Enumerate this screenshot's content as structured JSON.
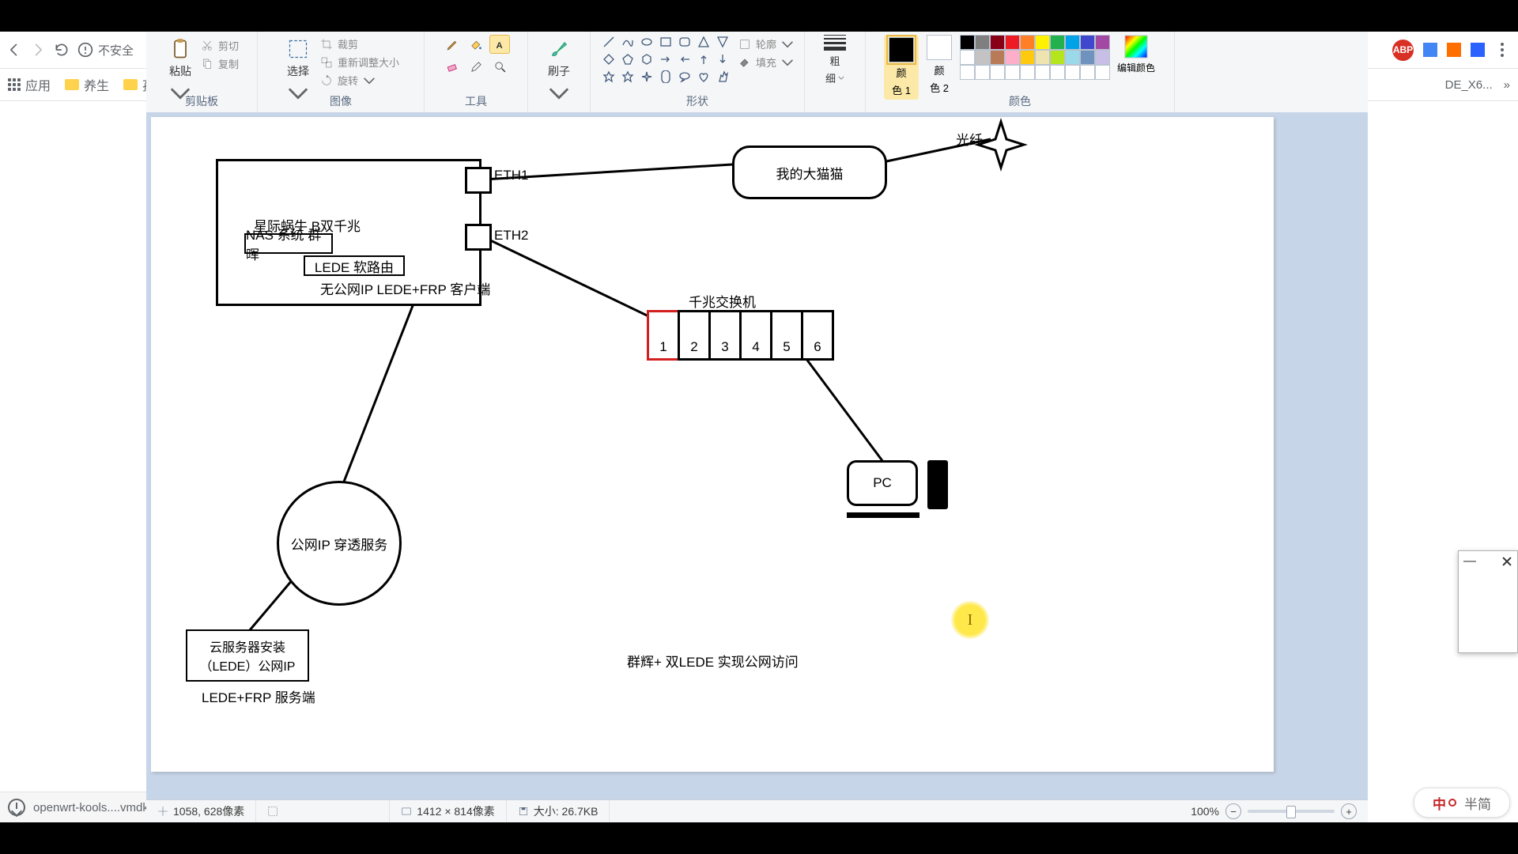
{
  "browser": {
    "back_tooltip": "后退",
    "forward_tooltip": "前进",
    "reload_tooltip": "刷新",
    "url_security_label": "不安全",
    "bookmarks": {
      "apps": "应用",
      "f1": "养生",
      "f2": "孩子"
    },
    "download_filename": "openwrt-kools....vmdk",
    "right_bookmark": "DE_X6...",
    "ext_adblock": "ABP",
    "bookmark_overflow": "»"
  },
  "ime": {
    "mode": "中",
    "engine": "半简"
  },
  "paint": {
    "ribbon": {
      "g_clipboard": "剪贴板",
      "paste": "粘贴",
      "cut": "剪切",
      "copy": "复制",
      "g_image": "图像",
      "select": "选择",
      "crop": "裁剪",
      "resize": "重新调整大小",
      "rotate": "旋转",
      "g_tools": "工具",
      "g_shapes": "形状",
      "brush": "刷子",
      "outline": "轮廓",
      "fill": "填充",
      "g_thickness_l1": "粗",
      "g_thickness_l2": "细",
      "g_colors": "颜色",
      "color1_l1": "颜",
      "color1_l2": "色 1",
      "color2_l1": "颜",
      "color2_l2": "色 2",
      "edit_colors": "编辑颜色"
    },
    "palette": {
      "row1": [
        "#000000",
        "#7f7f7f",
        "#880015",
        "#ed1c24",
        "#ff7f27",
        "#fff200",
        "#22b14c",
        "#00a2e8",
        "#3f48cc",
        "#a349a4"
      ],
      "row2": [
        "#ffffff",
        "#c3c3c3",
        "#b97a57",
        "#ffaec9",
        "#ffc90e",
        "#efe4b0",
        "#b5e61d",
        "#99d9ea",
        "#7092be",
        "#c8bfe7"
      ],
      "row3": [
        "#ffffff",
        "#ffffff",
        "#ffffff",
        "#ffffff",
        "#ffffff",
        "#ffffff",
        "#ffffff",
        "#ffffff",
        "#ffffff",
        "#ffffff"
      ]
    },
    "status": {
      "cursor": "1058, 628像素",
      "canvas_dims": "1412 × 814像素",
      "filesize": "大小: 26.7KB",
      "zoom": "100%"
    }
  },
  "diagram": {
    "eth1": "ETH1",
    "eth2": "ETH2",
    "nas_line1": "星际蜗牛 B双千兆",
    "nas_line2": "NAS 系统 群晖",
    "lede_soft": "LEDE 软路由",
    "no_public_ip": "无公网IP LEDE+FRP 客户端",
    "modem": "我的大猫猫",
    "fiber": "光纤",
    "switch_title": "千兆交换机",
    "switch_ports": [
      "1",
      "2",
      "3",
      "4",
      "5",
      "6"
    ],
    "pc": "PC",
    "circle": "公网IP 穿透服务",
    "cloud_l1": "云服务器安装",
    "cloud_l2": "（LEDE）公网IP",
    "cloud_sub": "LEDE+FRP 服务端",
    "caption": "群辉+ 双LEDE 实现公网访问"
  }
}
